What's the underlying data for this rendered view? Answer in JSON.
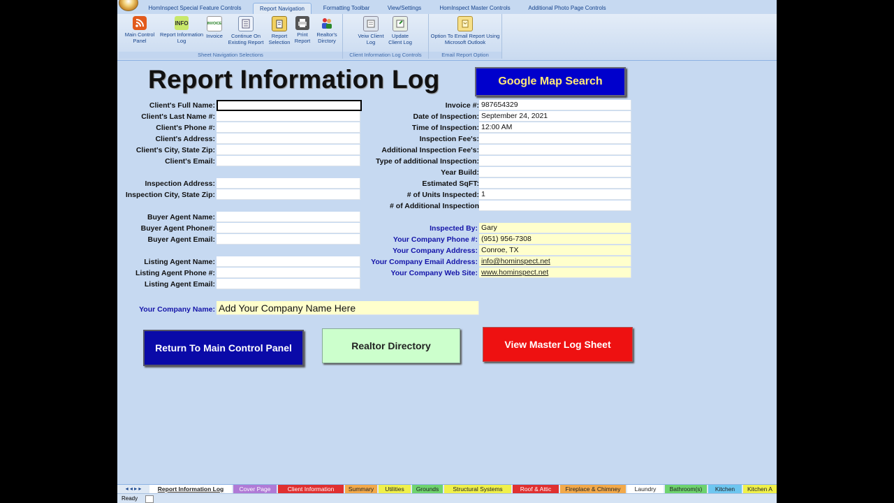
{
  "ribbon": {
    "tabs": [
      "HomInspect Special Feature Controls",
      "Report Navigation",
      "Formatting Toolbar",
      "View/Settings",
      "HomInspect Master Controls",
      "Additional Photo Page Controls"
    ],
    "groups": {
      "sheet_nav": {
        "caption": "Sheet Navigation Selections",
        "buttons": {
          "main_control": "Main Control Panel",
          "report_info": "Report Information Log",
          "invoice": "Invoice",
          "continue": "Continue On Existing Report",
          "report_selection": "Report Selection",
          "print_report": "Print Report",
          "realtors": "Realtor's Dirctory"
        }
      },
      "client_log": {
        "caption": "Client Information Log Controls",
        "buttons": {
          "view": "Veiw Client Log",
          "update": "Update Client Log"
        }
      },
      "email": {
        "caption": "Email Report Option",
        "buttons": {
          "option": "Option To Email Report Using Microsoft Outlook"
        }
      }
    },
    "icons": {
      "info": "INFO",
      "invoice": "INVOICE"
    }
  },
  "page": {
    "title": "Report Information Log",
    "google_btn": "Google Map Search"
  },
  "client": {
    "full_name_label": "Client's Full Name:",
    "last_name_label": "Client's Last Name #:",
    "phone_label": "Client's Phone #:",
    "address_label": "Client's Address:",
    "city_label": "Client's City, State Zip:",
    "email_label": "Client's Email:",
    "insp_address_label": "Inspection Address:",
    "insp_city_label": "Inspection City, State Zip:",
    "buyer_name_label": "Buyer Agent Name:",
    "buyer_phone_label": "Buyer Agent Phone#:",
    "buyer_email_label": "Buyer Agent Email:",
    "listing_name_label": "Listing Agent Name:",
    "listing_phone_label": "Listing Agent Phone #:",
    "listing_email_label": "Listing Agent Email:",
    "company_name_label": "Your Company Name:",
    "company_name_value": "Add Your Company Name Here"
  },
  "invoice": {
    "invoice_label": "Invoice #:",
    "invoice_value": "987654329",
    "date_label": "Date of Inspection:",
    "date_value": "September 24, 2021",
    "time_label": "Time of Inspection:",
    "time_value": "12:00 AM",
    "fee_label": "Inspection Fee's:",
    "add_fee_label": "Additional Inspection Fee's:",
    "type_label": "Type of additional Inspection:",
    "year_label": "Year Build:",
    "sqft_label": "Estimated SqFT:",
    "units_label": "# of Units Inspected:",
    "units_value": "1",
    "add_insp_label": "# of Additional Inspection"
  },
  "company": {
    "inspected_label": "Inspected By:",
    "inspected_value": "Gary",
    "phone_label": "Your Company Phone #:",
    "phone_value": "(951) 956-7308",
    "address_label": "Your Company Address:",
    "address_value": "Conroe, TX",
    "email_label": "Your Company Email Address:",
    "email_value": "info@hominspect.net",
    "web_label": "Your Company Web Site:",
    "web_value": "www.hominspect.net"
  },
  "buttons": {
    "main_panel": "Return To Main Control Panel",
    "realtor": "Realtor  Directory",
    "master_log": "View Master Log Sheet"
  },
  "sheet_tabs": [
    "Report Information Log",
    "Cover Page",
    "Client Information",
    "Summary",
    "Utilities",
    "Grounds",
    "Structural Systems",
    "Roof & Attic",
    "Fireplace & Chimney",
    "Laundry",
    "Bathroom(s)",
    "Kitchen",
    "Kitchen A"
  ],
  "status": {
    "ready": "Ready"
  },
  "colors": {
    "google_btn": "#0000cc",
    "main_btn": "#0a0aa8",
    "realtor_btn": "#ccffcc",
    "master_btn": "#ee1111",
    "company_yellow": "#ffffcc"
  }
}
